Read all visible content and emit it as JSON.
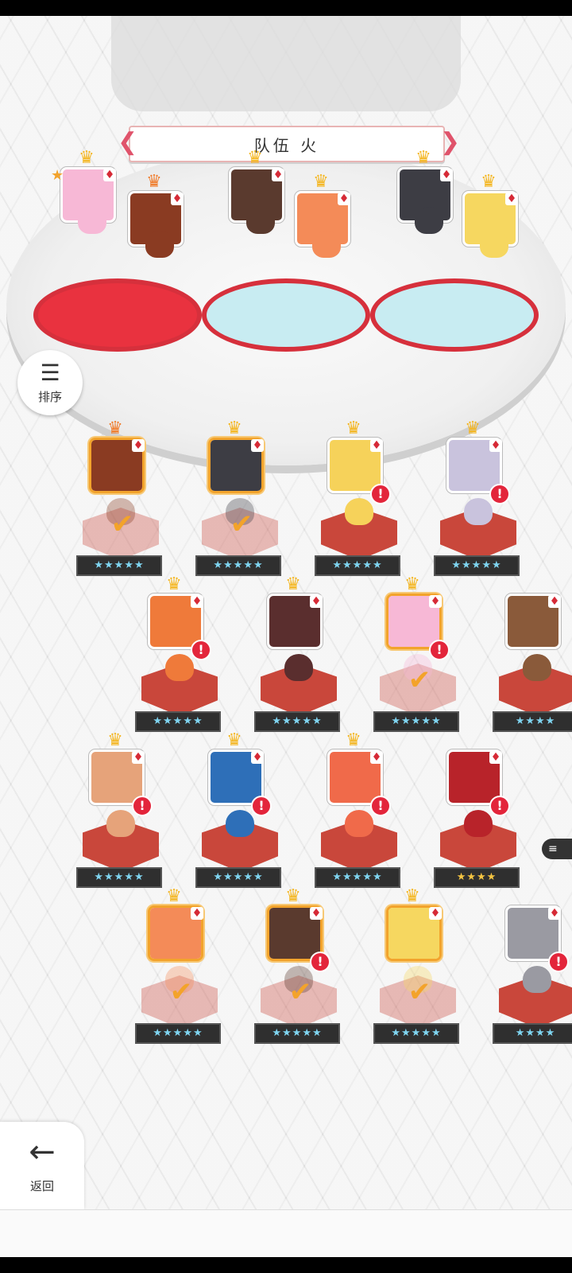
{
  "team": {
    "title": "队伍 火"
  },
  "sort_button": {
    "label": "排序"
  },
  "back_button": {
    "label": "返回"
  },
  "colors": {
    "accent": "#e0536b",
    "selected_border": "#f2a32c",
    "alert": "#e3253b",
    "pedestal": "#c9473b"
  },
  "formation": [
    {
      "portrait": "#f7b8d6",
      "crown": "gold",
      "suit": "♦",
      "leader_star": "★"
    },
    {
      "portrait": "#8a3b22",
      "crown": "orange",
      "suit": "♦"
    },
    {
      "portrait": "#5a3a2e",
      "crown": "gold",
      "suit": "♦"
    },
    {
      "portrait": "#f48b58",
      "crown": "gold",
      "suit": "♦"
    },
    {
      "portrait": "#3d3d44",
      "crown": "gold",
      "suit": "♦"
    },
    {
      "portrait": "#f6d760",
      "crown": "gold",
      "suit": "♦"
    }
  ],
  "roster": [
    {
      "portrait": "#8a3b22",
      "crown": "orange",
      "suit": "♦",
      "selected": true,
      "alert": false,
      "stars": "★★★★★",
      "checked": "✔"
    },
    {
      "portrait": "#3d3d44",
      "crown": "gold",
      "suit": "♦",
      "selected": true,
      "alert": false,
      "stars": "★★★★★",
      "checked": "✔"
    },
    {
      "portrait": "#f6d25a",
      "crown": "gold",
      "suit": "♦",
      "selected": false,
      "alert": "!",
      "stars": "★★★★★"
    },
    {
      "portrait": "#c9c3dd",
      "crown": "gold",
      "suit": "♦",
      "selected": false,
      "alert": "!",
      "stars": "★★★★★"
    },
    {
      "portrait": "#ef7a3a",
      "crown": "gold",
      "suit": "♦",
      "selected": false,
      "alert": "!",
      "stars": "★★★★★"
    },
    {
      "portrait": "#5a2e2e",
      "crown": "gold",
      "suit": "♦",
      "selected": false,
      "alert": false,
      "stars": "★★★★★"
    },
    {
      "portrait": "#f7b8d6",
      "crown": "gold",
      "suit": "♦",
      "selected": true,
      "alert": "!",
      "stars": "★★★★★",
      "checked": "✔"
    },
    {
      "portrait": "#8a5a3a",
      "crown": "",
      "suit": "♦",
      "selected": false,
      "alert": false,
      "stars": "★★★★"
    },
    {
      "portrait": "#e6a37a",
      "crown": "gold",
      "suit": "♦",
      "selected": false,
      "alert": "!",
      "stars": "★★★★★"
    },
    {
      "portrait": "#2e6fb8",
      "crown": "gold",
      "suit": "♦",
      "selected": false,
      "alert": "!",
      "stars": "★★★★★"
    },
    {
      "portrait": "#f06a4a",
      "crown": "gold",
      "suit": "♦",
      "selected": false,
      "alert": "!",
      "stars": "★★★★★"
    },
    {
      "portrait": "#b8232a",
      "crown": "",
      "suit": "♦",
      "selected": false,
      "alert": "!",
      "stars": "★★★★",
      "gold_stars": true
    },
    {
      "portrait": "#f48b58",
      "crown": "gold",
      "suit": "♦",
      "selected": true,
      "alert": false,
      "stars": "★★★★★",
      "checked": "✔"
    },
    {
      "portrait": "#5a3a2e",
      "crown": "gold",
      "suit": "♦",
      "selected": true,
      "alert": "!",
      "stars": "★★★★★",
      "checked": "✔"
    },
    {
      "portrait": "#f6d760",
      "crown": "gold",
      "suit": "♦",
      "selected": true,
      "alert": false,
      "stars": "★★★★★",
      "checked": "✔"
    },
    {
      "portrait": "#9a9aa2",
      "crown": "",
      "suit": "♦",
      "selected": false,
      "alert": "!",
      "stars": "★★★★"
    }
  ],
  "chat_tab": {
    "icon": "≡"
  }
}
